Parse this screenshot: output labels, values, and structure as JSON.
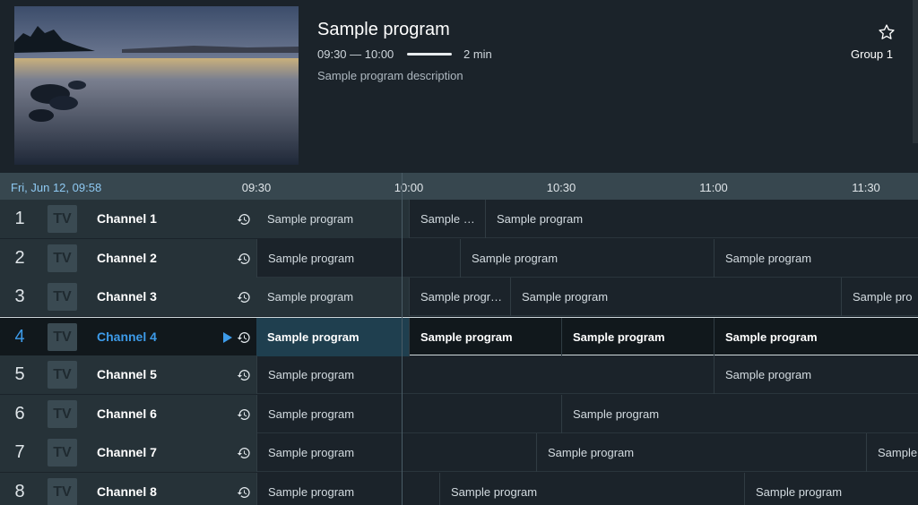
{
  "info": {
    "title": "Sample program",
    "time": "09:30 — 10:00",
    "progress": 0.93,
    "duration": "2 min",
    "description": "Sample program description",
    "group": "Group 1",
    "favorite_icon": "star-outline-icon"
  },
  "timeline": {
    "date": "Fri, Jun 12, 09:58",
    "ticks": [
      "09:30",
      "10:00",
      "10:30",
      "11:00",
      "11:30"
    ]
  },
  "channels": [
    {
      "num": "1",
      "name": "Channel 1",
      "logo": "TV",
      "programs": [
        {
          "title": "Sample program",
          "start": "09:30",
          "end": "10:00"
        },
        {
          "title": "Sample …",
          "start": "10:00",
          "end": "10:15"
        },
        {
          "title": "Sample program",
          "start": "10:15",
          "end": "11:45"
        }
      ]
    },
    {
      "num": "2",
      "name": "Channel 2",
      "logo": "TV",
      "programs": [
        {
          "title": "Sample program",
          "start": "09:30",
          "end": "10:10"
        },
        {
          "title": "Sample program",
          "start": "10:10",
          "end": "11:00"
        },
        {
          "title": "Sample program",
          "start": "11:00",
          "end": "11:45"
        }
      ]
    },
    {
      "num": "3",
      "name": "Channel 3",
      "logo": "TV",
      "programs": [
        {
          "title": "Sample program",
          "start": "09:30",
          "end": "10:00"
        },
        {
          "title": "Sample progr…",
          "start": "10:00",
          "end": "10:20"
        },
        {
          "title": "Sample program",
          "start": "10:20",
          "end": "11:25"
        },
        {
          "title": "Sample pro",
          "start": "11:25",
          "end": "11:45"
        }
      ]
    },
    {
      "num": "4",
      "name": "Channel 4",
      "logo": "TV",
      "selected": true,
      "programs": [
        {
          "title": "Sample program",
          "start": "09:30",
          "end": "10:00"
        },
        {
          "title": "Sample program",
          "start": "10:00",
          "end": "10:30"
        },
        {
          "title": "Sample program",
          "start": "10:30",
          "end": "11:00"
        },
        {
          "title": "Sample program",
          "start": "11:00",
          "end": "11:45"
        }
      ]
    },
    {
      "num": "5",
      "name": "Channel 5",
      "logo": "TV",
      "programs": [
        {
          "title": "Sample program",
          "start": "09:30",
          "end": "11:00"
        },
        {
          "title": "Sample program",
          "start": "11:00",
          "end": "11:45"
        }
      ]
    },
    {
      "num": "6",
      "name": "Channel 6",
      "logo": "TV",
      "programs": [
        {
          "title": "Sample program",
          "start": "09:30",
          "end": "10:30"
        },
        {
          "title": "Sample program",
          "start": "10:30",
          "end": "11:45"
        }
      ]
    },
    {
      "num": "7",
      "name": "Channel 7",
      "logo": "TV",
      "programs": [
        {
          "title": "Sample program",
          "start": "09:30",
          "end": "10:25"
        },
        {
          "title": "Sample program",
          "start": "10:25",
          "end": "11:30"
        },
        {
          "title": "Sample",
          "start": "11:30",
          "end": "11:45"
        }
      ]
    },
    {
      "num": "8",
      "name": "Channel 8",
      "logo": "TV",
      "programs": [
        {
          "title": "Sample program",
          "start": "09:30",
          "end": "10:06"
        },
        {
          "title": "Sample program",
          "start": "10:06",
          "end": "11:06"
        },
        {
          "title": "Sample program",
          "start": "11:06",
          "end": "11:45"
        }
      ]
    }
  ],
  "colors": {
    "accent": "#3d9be9",
    "background": "#1b232a",
    "timeline": "#37474f"
  }
}
